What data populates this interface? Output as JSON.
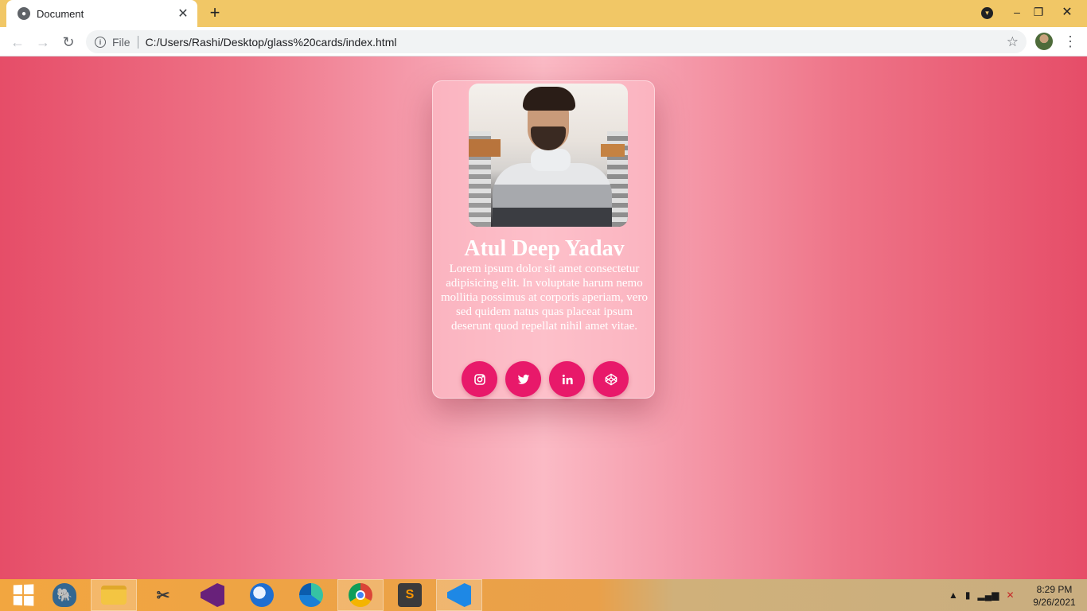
{
  "browser": {
    "tab_title": "Document",
    "tab_close": "✕",
    "new_tab": "+",
    "scheme": "File",
    "url": "C:/Users/Rashi/Desktop/glass%20cards/index.html",
    "back": "←",
    "forward": "→",
    "reload": "↻",
    "bookmark_star": "☆",
    "menu": "⋮",
    "window_minimize": "–",
    "window_restore": "❐",
    "window_close": "✕"
  },
  "card": {
    "name": "Atul Deep Yadav",
    "description": "Lorem ipsum dolor sit amet consectetur adipisicing elit. In voluptate harum nemo mollitia possimus at corporis aperiam, vero sed quidem natus quas placeat ipsum deserunt quod repellat nihil amet vitae.",
    "socials": [
      {
        "icon": "instagram-icon"
      },
      {
        "icon": "twitter-icon"
      },
      {
        "icon": "linkedin-icon"
      },
      {
        "icon": "codepen-icon"
      }
    ]
  },
  "taskbar": {
    "apps": [
      "pgadmin",
      "file-explorer",
      "snipping-tool",
      "visual-studio",
      "thunderbird",
      "edge",
      "chrome",
      "sublime-text",
      "vscode"
    ],
    "time": "8:29 PM",
    "date": "9/26/2021"
  },
  "colors": {
    "accent": "#e8196a",
    "titlebar": "#f1c766"
  }
}
